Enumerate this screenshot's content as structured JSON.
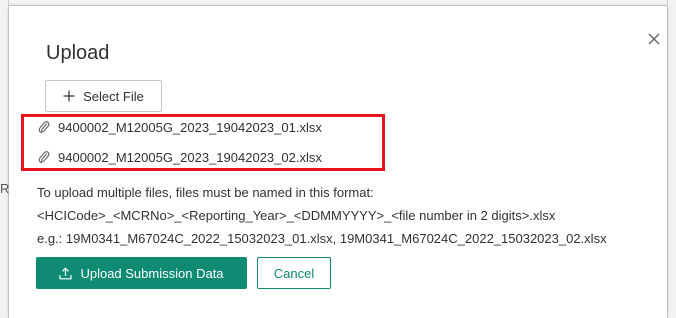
{
  "dialog": {
    "title": "Upload",
    "close_icon": "close-icon",
    "select_file_button": {
      "icon": "plus-icon",
      "label": "Select File"
    },
    "files": [
      {
        "icon": "paperclip-icon",
        "name": "9400002_M12005G_2023_19042023_01.xlsx"
      },
      {
        "icon": "paperclip-icon",
        "name": "9400002_M12005G_2023_19042023_02.xlsx"
      }
    ],
    "highlight_color": "#e8141d",
    "instructions": [
      "To upload multiple files, files must be named in this format:",
      "<HCICode>_<MCRNo>_<Reporting_Year>_<DDMMYYYY>_<file number in 2 digits>.xlsx",
      "e.g.: 19M0341_M67024C_2022_15032023_01.xlsx, 19M0341_M67024C_2022_15032023_02.xlsx"
    ],
    "upload_button": {
      "icon": "upload-icon",
      "label": "Upload Submission Data",
      "color": "#0f8a73"
    },
    "cancel_button": {
      "label": "Cancel"
    }
  },
  "backdrop": {
    "fragment_text": "R"
  }
}
